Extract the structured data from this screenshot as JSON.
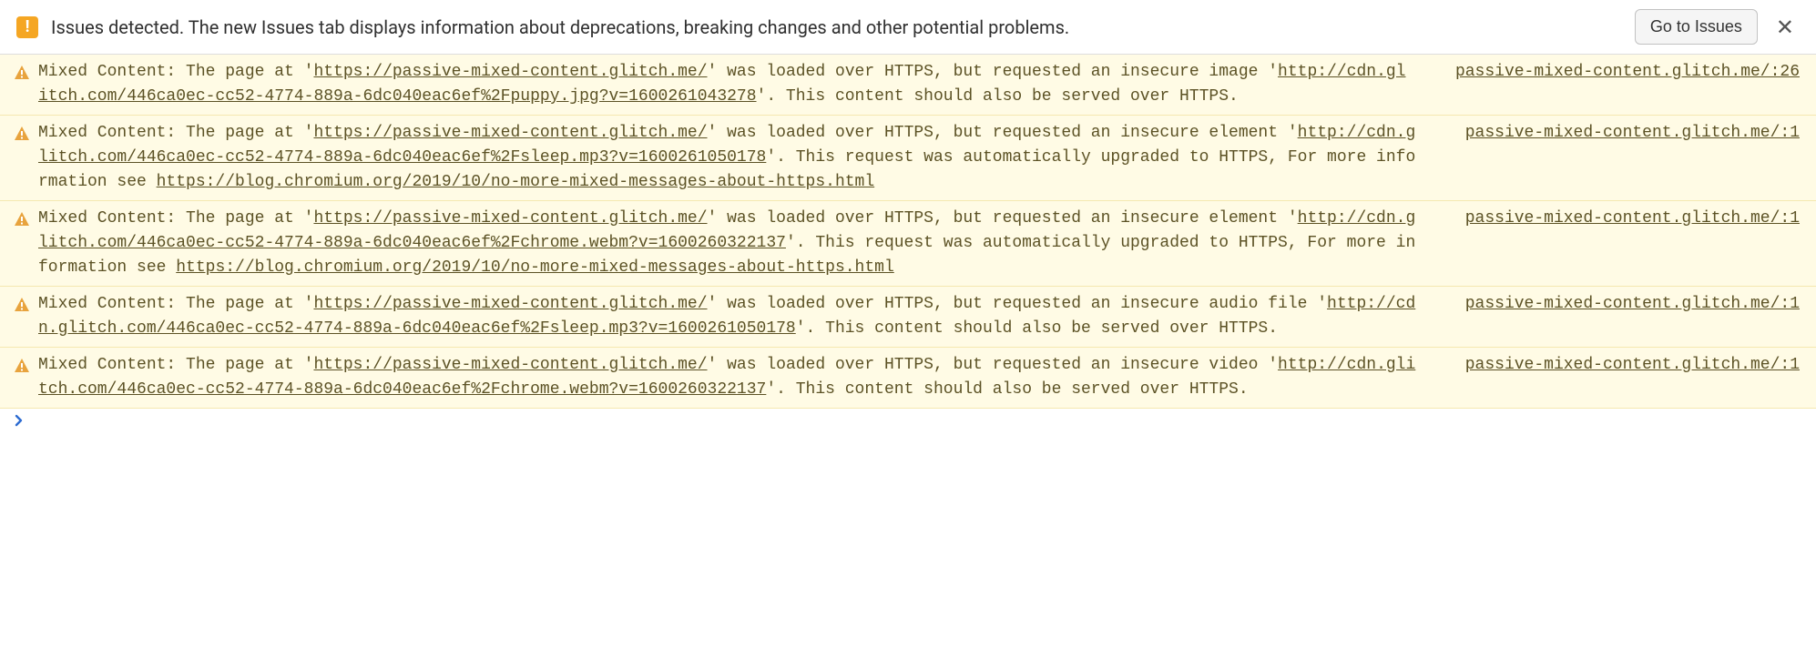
{
  "header": {
    "text": "Issues detected. The new Issues tab displays information about deprecations, breaking changes and other potential problems.",
    "button": "Go to Issues"
  },
  "messages": [
    {
      "source": "passive-mixed-content.glitch.me/:26",
      "parts": [
        {
          "t": "text",
          "v": "Mixed Content: The page at '"
        },
        {
          "t": "link",
          "v": "https://passive-mixed-content.glitch.me/"
        },
        {
          "t": "text",
          "v": "' was loaded over HTTPS, but requested an insecure image '"
        },
        {
          "t": "link",
          "v": "http://cdn.glitch.com/446ca0ec-cc52-4774-889a-6dc040eac6ef%2Fpuppy.jpg?v=1600261043278"
        },
        {
          "t": "text",
          "v": "'. This content should also be served over HTTPS."
        }
      ]
    },
    {
      "source": "passive-mixed-content.glitch.me/:1",
      "parts": [
        {
          "t": "text",
          "v": "Mixed Content: The page at '"
        },
        {
          "t": "link",
          "v": "https://passive-mixed-content.glitch.me/"
        },
        {
          "t": "text",
          "v": "' was loaded over HTTPS, but requested an insecure element '"
        },
        {
          "t": "link",
          "v": "http://cdn.glitch.com/446ca0ec-cc52-4774-889a-6dc040eac6ef%2Fsleep.mp3?v=1600261050178"
        },
        {
          "t": "text",
          "v": "'. This request was automatically upgraded to HTTPS, For more information see "
        },
        {
          "t": "link",
          "v": "https://blog.chromium.org/2019/10/no-more-mixed-messages-about-https.html"
        }
      ]
    },
    {
      "source": "passive-mixed-content.glitch.me/:1",
      "parts": [
        {
          "t": "text",
          "v": "Mixed Content: The page at '"
        },
        {
          "t": "link",
          "v": "https://passive-mixed-content.glitch.me/"
        },
        {
          "t": "text",
          "v": "' was loaded over HTTPS, but requested an insecure element '"
        },
        {
          "t": "link",
          "v": "http://cdn.glitch.com/446ca0ec-cc52-4774-889a-6dc040eac6ef%2Fchrome.webm?v=1600260322137"
        },
        {
          "t": "text",
          "v": "'. This request was automatically upgraded to HTTPS, For more information see "
        },
        {
          "t": "link",
          "v": "https://blog.chromium.org/2019/10/no-more-mixed-messages-about-https.html"
        }
      ]
    },
    {
      "source": "passive-mixed-content.glitch.me/:1",
      "parts": [
        {
          "t": "text",
          "v": "Mixed Content: The page at '"
        },
        {
          "t": "link",
          "v": "https://passive-mixed-content.glitch.me/"
        },
        {
          "t": "text",
          "v": "' was loaded over HTTPS, but requested an insecure audio file '"
        },
        {
          "t": "link",
          "v": "http://cdn.glitch.com/446ca0ec-cc52-4774-889a-6dc040eac6ef%2Fsleep.mp3?v=1600261050178"
        },
        {
          "t": "text",
          "v": "'. This content should also be served over HTTPS."
        }
      ]
    },
    {
      "source": "passive-mixed-content.glitch.me/:1",
      "parts": [
        {
          "t": "text",
          "v": "Mixed Content: The page at '"
        },
        {
          "t": "link",
          "v": "https://passive-mixed-content.glitch.me/"
        },
        {
          "t": "text",
          "v": "' was loaded over HTTPS, but requested an insecure video '"
        },
        {
          "t": "link",
          "v": "http://cdn.glitch.com/446ca0ec-cc52-4774-889a-6dc040eac6ef%2Fchrome.webm?v=1600260322137"
        },
        {
          "t": "text",
          "v": "'. This content should also be served over HTTPS."
        }
      ]
    }
  ]
}
